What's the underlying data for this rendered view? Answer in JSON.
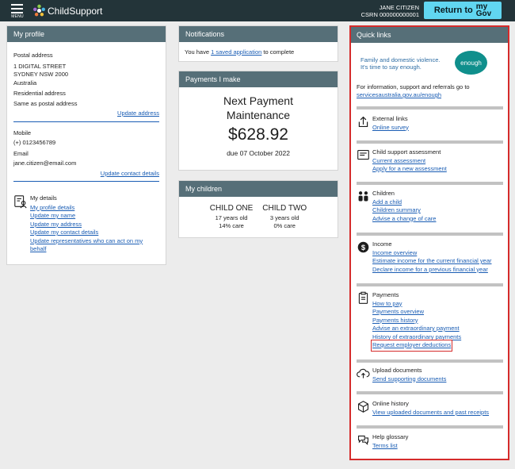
{
  "header": {
    "menu_label": "MENU",
    "app_name": "ChildSupport",
    "user_name": "JANE CITIZEN",
    "csrn": "CSRN 000000000001",
    "return_label": "Return to",
    "mygov_top": "my",
    "mygov_bottom": "Gov"
  },
  "profile": {
    "title": "My profile",
    "postal_label": "Postal address",
    "postal_line1": "1 DIGITAL STREET",
    "postal_line2": "SYDNEY NSW 2000",
    "postal_line3": "Australia",
    "residential_label": "Residential address",
    "residential_value": "Same as postal address",
    "update_address": "Update address",
    "mobile_label": "Mobile",
    "mobile_value": "(+) 0123456789",
    "email_label": "Email",
    "email_value": "jane.citizen@email.com",
    "update_contact": "Update contact details",
    "details_title": "My details",
    "details_links": [
      "My profile details",
      "Update my name",
      "Update my address",
      "Update my contact details",
      "Update representatives who can act on my",
      "behalf"
    ]
  },
  "notifications": {
    "title": "Notifications",
    "prefix": "You have",
    "link": "1 saved application",
    "suffix": "to complete"
  },
  "payments": {
    "title": "Payments I make",
    "line1": "Next Payment",
    "line2": "Maintenance",
    "amount": "$628.92",
    "due": "due 07 October 2022"
  },
  "children": {
    "title": "My children",
    "kids": [
      {
        "name": "CHILD ONE",
        "age": "17 years old",
        "care": "14% care"
      },
      {
        "name": "CHILD TWO",
        "age": "3 years old",
        "care": "0% care"
      }
    ]
  },
  "quicklinks": {
    "title": "Quick links",
    "banner_line1": "Family and domestic violence.",
    "banner_line2": "It's time to say enough.",
    "banner_logo": "enough",
    "info_text": "For information, support and referrals go to",
    "info_link": "servicesaustralia.gov.au/enough",
    "sections": [
      {
        "title": "External links",
        "icon": "external-link-icon",
        "links": [
          "Online survey"
        ]
      },
      {
        "title": "Child support assessment",
        "icon": "document-icon",
        "links": [
          "Current assessment",
          "Apply for a new assessment"
        ]
      },
      {
        "title": "Children",
        "icon": "children-icon",
        "links": [
          "Add a child",
          "Children summary",
          "Advise a change of care"
        ]
      },
      {
        "title": "Income",
        "icon": "dollar-icon",
        "links": [
          "Income overview",
          "Estimate income for the current financial year",
          "Declare income for a previous financial year"
        ]
      },
      {
        "title": "Payments",
        "icon": "clipboard-icon",
        "links": [
          "How to pay",
          "Payments overview",
          "Payments history",
          "Advise an extraordinary payment",
          "History of extraordinary payments",
          "Request employer deductions"
        ]
      },
      {
        "title": "Upload documents",
        "icon": "upload-icon",
        "links": [
          "Send supporting documents"
        ]
      },
      {
        "title": "Online history",
        "icon": "box-icon",
        "links": [
          "View uploaded documents and past receipts"
        ]
      },
      {
        "title": "Help glossary",
        "icon": "chat-icon",
        "links": [
          "Terms list"
        ]
      }
    ]
  },
  "colors": {
    "topbar": "#233439",
    "card_header": "#566f78",
    "link": "#1a5db4",
    "mygov_button": "#61d6f1",
    "highlight": "#d52b2b"
  }
}
